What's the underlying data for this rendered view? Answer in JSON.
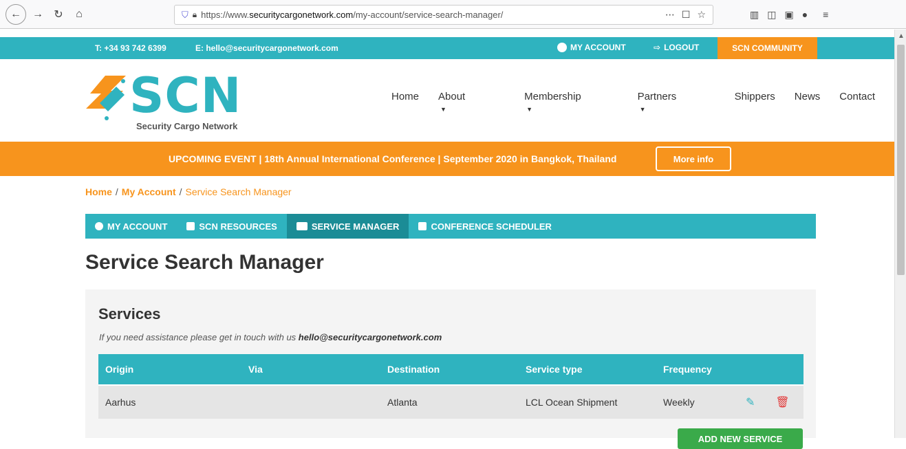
{
  "browser": {
    "url_prefix": "https://www.",
    "url_domain": "securitycargonetwork.com",
    "url_path": "/my-account/service-search-manager/",
    "icons": [
      "back-icon",
      "forward-icon",
      "reload-icon",
      "home-icon",
      "shield-icon",
      "lock-icon",
      "more-icon",
      "pocket-icon",
      "star-icon",
      "library-icon",
      "sidebar-icon",
      "extension-icon",
      "account-icon",
      "menu-icon"
    ]
  },
  "topbar": {
    "phone": "T: +34 93 742 6399",
    "email": "E: hello@securitycargonetwork.com",
    "my_account": "MY ACCOUNT",
    "logout": "LOGOUT",
    "community": "SCN COMMUNITY"
  },
  "logo": {
    "name": "SCN",
    "tagline": "Security Cargo Network"
  },
  "nav": {
    "home": "Home",
    "about": "About",
    "membership": "Membership",
    "partners": "Partners",
    "shippers": "Shippers",
    "news": "News",
    "contact": "Contact"
  },
  "event": {
    "text": "UPCOMING EVENT | 18th Annual International Conference | September 2020 in Bangkok, Thailand",
    "button": "More info"
  },
  "breadcrumb": {
    "home": "Home",
    "account": "My Account",
    "current": "Service Search Manager",
    "sep": "/"
  },
  "tabs": {
    "my_account": "MY ACCOUNT",
    "resources": "SCN RESOURCES",
    "service_manager": "SERVICE MANAGER",
    "scheduler": "CONFERENCE SCHEDULER"
  },
  "page": {
    "title": "Service Search Manager"
  },
  "services": {
    "heading": "Services",
    "assist_text": "If you need assistance please get in touch with us ",
    "assist_email": "hello@securitycargonetwork.com",
    "columns": {
      "origin": "Origin",
      "via": "Via",
      "destination": "Destination",
      "service_type": "Service type",
      "frequency": "Frequency"
    },
    "rows": [
      {
        "origin": "Aarhus",
        "via": "",
        "destination": "Atlanta",
        "service_type": "LCL Ocean Shipment",
        "frequency": "Weekly"
      }
    ],
    "add_button": "ADD NEW SERVICE"
  },
  "colors": {
    "teal": "#2fb3bf",
    "orange": "#f7941d",
    "green": "#3aaa4a",
    "red": "#e23b3b"
  }
}
